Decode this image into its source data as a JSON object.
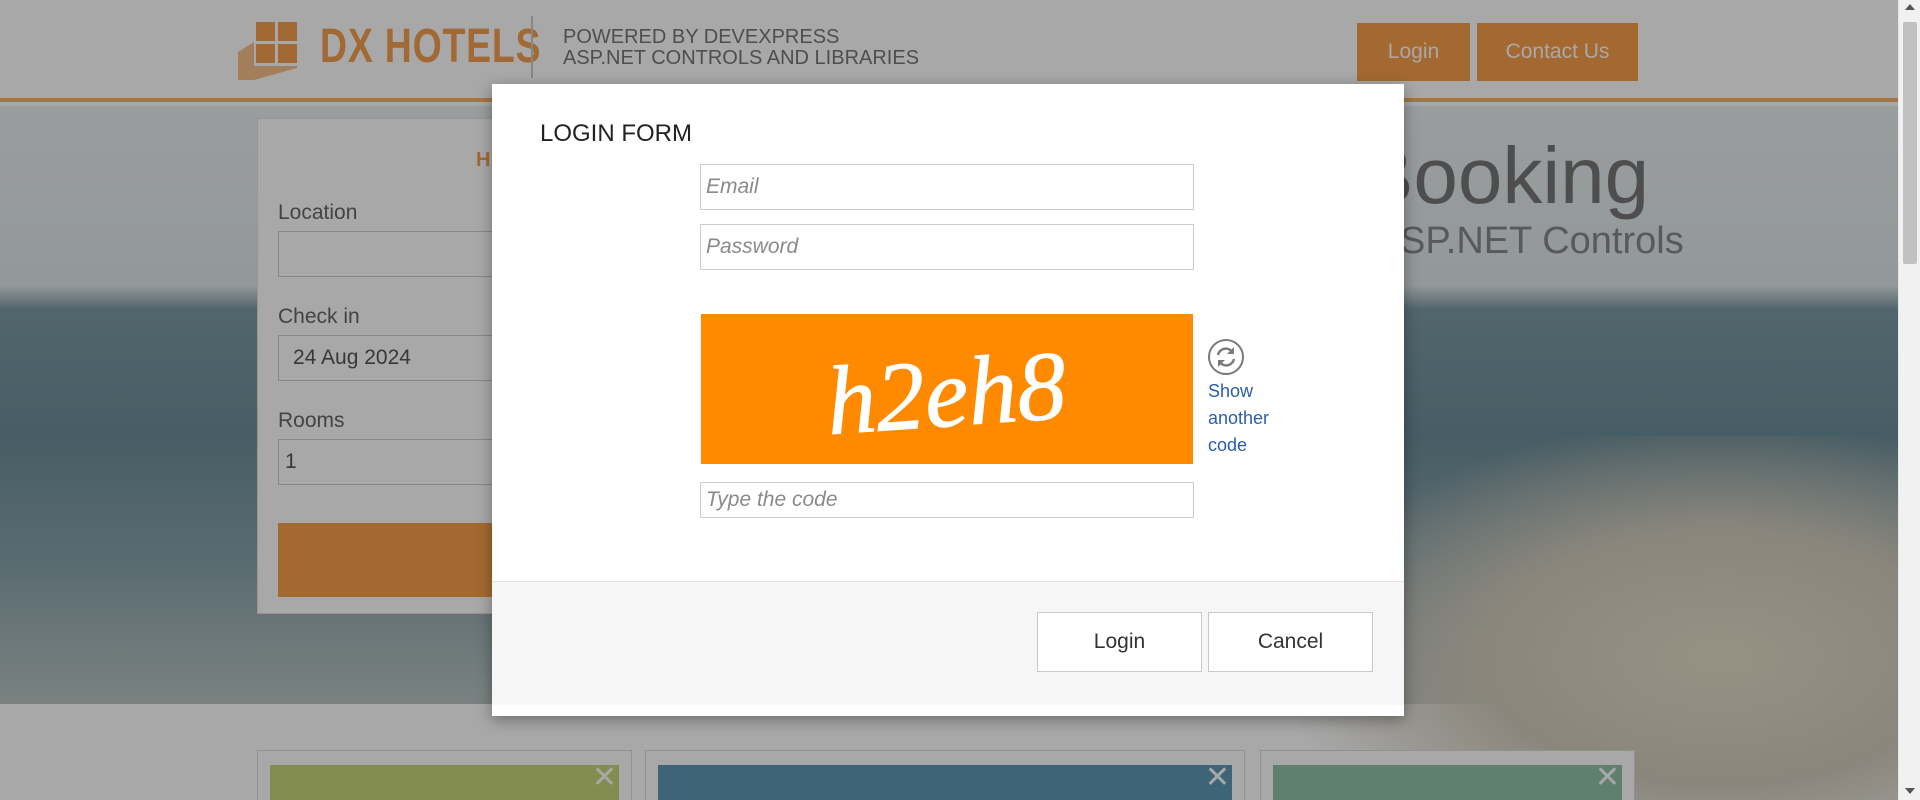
{
  "header": {
    "brand": "DX HOTELS",
    "powered_line1": "POWERED BY DEVEXPRESS",
    "powered_line2": "ASP.NET CONTROLS AND LIBRARIES",
    "login_label": "Login",
    "contact_label": "Contact Us"
  },
  "hero": {
    "title": "Booking",
    "subtitle": "SP.NET Controls"
  },
  "search_panel": {
    "heading": "H",
    "location_label": "Location",
    "location_value": "",
    "checkin_label": "Check in",
    "checkin_value": "24 Aug 2024",
    "rooms_label": "Rooms",
    "rooms_value": "1"
  },
  "cards": [
    {
      "color": "#c9d67a"
    },
    {
      "color": "#5f9ab5"
    },
    {
      "color": "#8fc2a4"
    }
  ],
  "login_form": {
    "title": "LOGIN FORM",
    "email_placeholder": "Email",
    "password_placeholder": "Password",
    "captcha_text": "h2eh8",
    "show_another_code": "Show another code",
    "code_placeholder": "Type the code",
    "login_button": "Login",
    "cancel_button": "Cancel"
  },
  "colors": {
    "accent": "#f7a04b",
    "captcha_bg": "#ff8a00",
    "link": "#2a5dad"
  }
}
